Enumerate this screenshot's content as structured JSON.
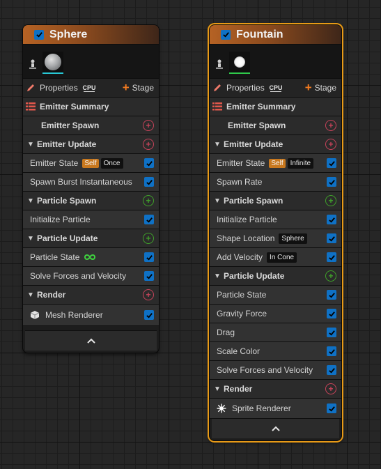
{
  "colors": {
    "accent_checkbox": "#0f71c5",
    "selected_outline": "#e89a16",
    "title_bar_orange": "#b56224"
  },
  "toolbar": {
    "properties_label": "Properties",
    "cpu_label": "CPU",
    "stage_label": "Stage"
  },
  "summary_label": "Emitter Summary",
  "emitters": {
    "sphere": {
      "title": "Sphere",
      "enabled": true,
      "sections": {
        "emitter_spawn": "Emitter Spawn",
        "emitter_update": "Emitter Update",
        "particle_spawn": "Particle Spawn",
        "particle_update": "Particle Update",
        "render": "Render"
      },
      "modules": {
        "emitter_state": "Emitter State",
        "emitter_state_tag1": "Self",
        "emitter_state_tag2": "Once",
        "spawn_burst": "Spawn Burst Instantaneous",
        "initialize_particle": "Initialize Particle",
        "particle_state": "Particle State",
        "solve_forces": "Solve Forces and Velocity",
        "mesh_renderer": "Mesh Renderer"
      }
    },
    "fountain": {
      "title": "Fountain",
      "enabled": true,
      "selected": true,
      "sections": {
        "emitter_spawn": "Emitter Spawn",
        "emitter_update": "Emitter Update",
        "particle_spawn": "Particle Spawn",
        "particle_update": "Particle Update",
        "render": "Render"
      },
      "modules": {
        "emitter_state": "Emitter State",
        "emitter_state_tag1": "Self",
        "emitter_state_tag2": "Infinite",
        "spawn_rate": "Spawn Rate",
        "initialize_particle": "Initialize Particle",
        "shape_location": "Shape Location",
        "shape_location_tag": "Sphere",
        "add_velocity": "Add Velocity",
        "add_velocity_tag": "In Cone",
        "particle_state": "Particle State",
        "gravity_force": "Gravity Force",
        "drag": "Drag",
        "scale_color": "Scale Color",
        "solve_forces": "Solve Forces and Velocity",
        "sprite_renderer": "Sprite Renderer"
      }
    }
  },
  "icons": [
    "checkbox-icon",
    "pin-icon",
    "pencil-icon",
    "cpu-icon",
    "plus-icon",
    "list-icon",
    "triangle-down-icon",
    "add-circle-icon",
    "infinity-icon",
    "mesh-renderer-icon",
    "sprite-renderer-icon",
    "chevron-up-icon"
  ]
}
